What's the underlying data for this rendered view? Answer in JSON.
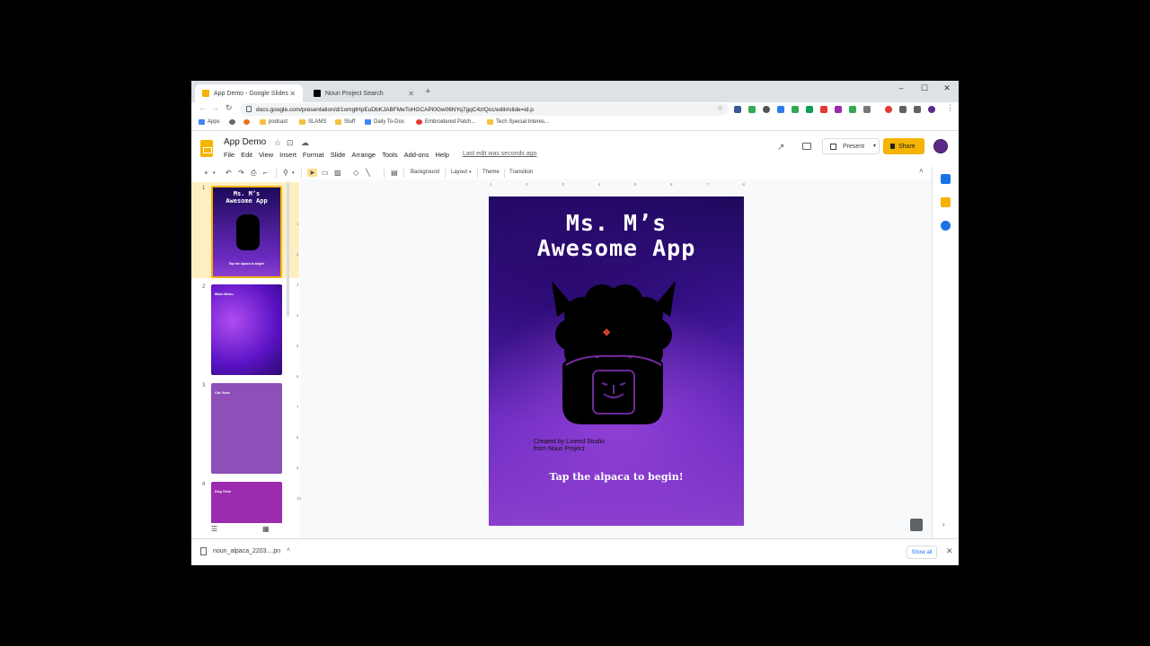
{
  "browser": {
    "tabs": [
      {
        "label": "App Demo - Google Slides",
        "color": "#f4b400"
      },
      {
        "label": "Noun Project Search",
        "color": "#000000"
      }
    ],
    "new_tab": "+",
    "window": {
      "minimize": "–",
      "maximize": "☐",
      "close": "✕"
    },
    "url": "docs.google.com/presentation/d/1omgtHpEuDbKJABFMeToHGCAPi0Gw06NYq7gqC4zlQcc/edit#slide=id.p",
    "bookmarks": [
      {
        "label": "Apps",
        "color": "#4285f4"
      },
      {
        "label": "",
        "color": "#666666"
      },
      {
        "label": "",
        "color": "#e8711a"
      },
      {
        "label": "podcast",
        "color": "#f6c142"
      },
      {
        "label": "SLAMS",
        "color": "#f6c142"
      },
      {
        "label": "Stuff",
        "color": "#f6c142"
      },
      {
        "label": "Daily To-Dos",
        "color": "#4285f4"
      },
      {
        "label": "Embroidered Patch...",
        "color": "#e53935"
      },
      {
        "label": "Tech Special Interes...",
        "color": "#f6c142"
      }
    ]
  },
  "slides_app": {
    "doc_title": "App Demo",
    "menu": [
      "File",
      "Edit",
      "View",
      "Insert",
      "Format",
      "Slide",
      "Arrange",
      "Tools",
      "Add-ons",
      "Help"
    ],
    "last_edit": "Last edit was seconds ago",
    "present_label": "Present",
    "share_label": "Share",
    "brand_color": "#f4b400"
  },
  "toolbar": {
    "background": "Background",
    "layout": "Layout",
    "theme": "Theme",
    "transition": "Transition"
  },
  "filmstrip": {
    "slides": [
      {
        "num": "1",
        "label": "Ms. M's Awesome App"
      },
      {
        "num": "2",
        "label": "Main Menu"
      },
      {
        "num": "3",
        "label": "Cat View"
      },
      {
        "num": "4",
        "label": "Dog View"
      }
    ]
  },
  "ruler": [
    "1",
    "2",
    "3",
    "4",
    "5",
    "6",
    "7",
    "8"
  ],
  "vruler": [
    "1",
    "2",
    "3",
    "4",
    "5",
    "6",
    "7",
    "8",
    "9",
    "10"
  ],
  "slide": {
    "title": "Ms. M’s\nAwesome App",
    "credit_line1": "Created by Lineed Studio",
    "credit_line2": "from Noun Project",
    "cta": "Tap the alpaca to begin!"
  },
  "downloads": {
    "file": "noun_alpaca_2203....pn",
    "show_all": "Show all"
  }
}
